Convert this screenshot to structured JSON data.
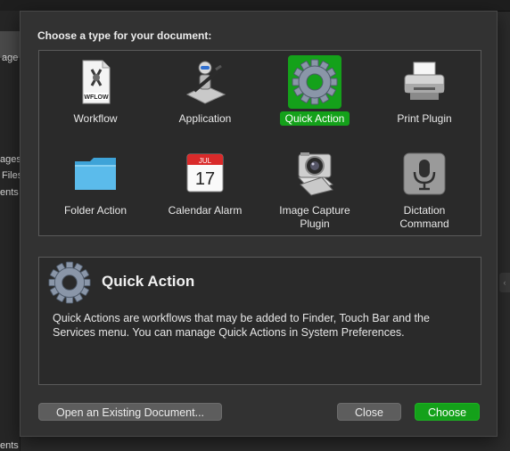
{
  "background": {
    "sidebar_fragments": [
      "age",
      "ages",
      "Files",
      "ents",
      "ents"
    ]
  },
  "sheet": {
    "prompt": "Choose a type for your document:",
    "types": [
      {
        "label": "Workflow",
        "icon": "workflow-document-icon",
        "icon_badge": "WFLOW",
        "selected": false
      },
      {
        "label": "Application",
        "icon": "automator-robot-icon",
        "selected": false
      },
      {
        "label": "Quick Action",
        "icon": "gear-icon",
        "selected": true
      },
      {
        "label": "Print Plugin",
        "icon": "printer-icon",
        "selected": false
      },
      {
        "label": "Folder Action",
        "icon": "folder-icon",
        "selected": false
      },
      {
        "label": "Calendar Alarm",
        "icon": "calendar-icon",
        "icon_month": "JUL",
        "icon_day": "17",
        "selected": false
      },
      {
        "label": "Image Capture Plugin",
        "label_lines": [
          "Image Capture",
          "Plugin"
        ],
        "icon": "camera-icon",
        "selected": false
      },
      {
        "label": "Dictation Command",
        "label_lines": [
          "Dictation",
          "Command"
        ],
        "icon": "microphone-icon",
        "selected": false
      }
    ],
    "details": {
      "icon": "gear-icon",
      "title": "Quick Action",
      "description": "Quick Actions are workflows that may be added to Finder, Touch Bar and the Services menu. You can manage Quick Actions in System Preferences."
    },
    "buttons": {
      "open_existing": "Open an Existing Document...",
      "close": "Close",
      "choose": "Choose"
    }
  },
  "colors": {
    "accent": "#14a11a",
    "sheet_background": "#323232",
    "panel_background": "#2a2a2a"
  }
}
